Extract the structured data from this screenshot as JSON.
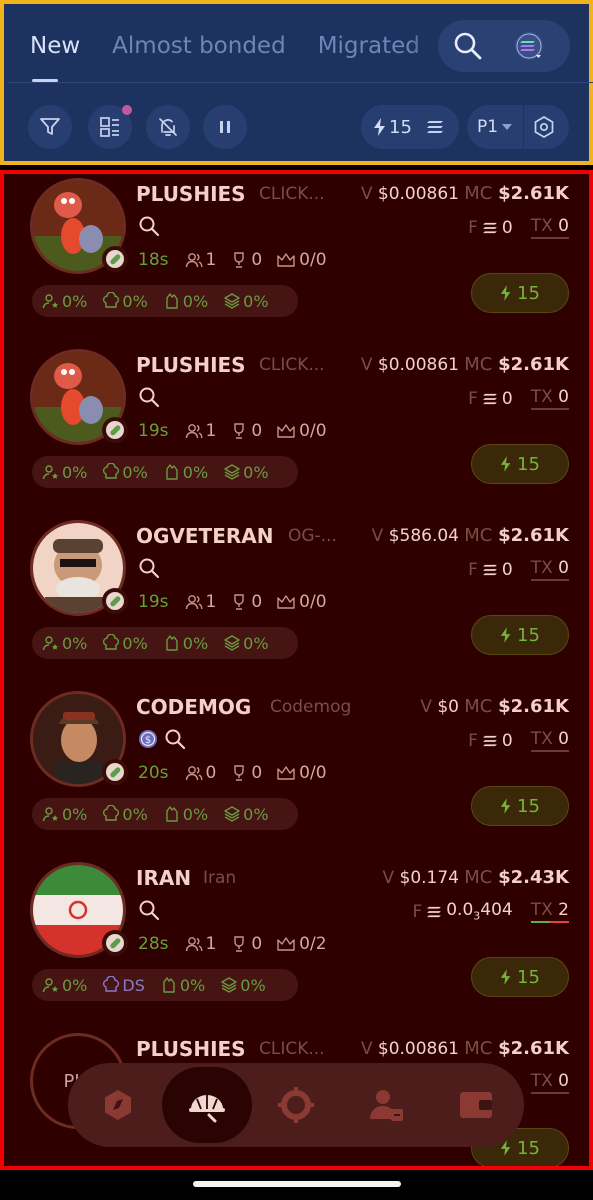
{
  "tabs": [
    {
      "label": "New",
      "active": true
    },
    {
      "label": "Almost bonded",
      "active": false
    },
    {
      "label": "Migrated",
      "active": false
    }
  ],
  "header": {
    "search_icon": "search-icon",
    "chain_icon": "solana-icon",
    "filter_icon": "filter-icon",
    "layout_icon": "layout-icon",
    "mute_icon": "bell-off-icon",
    "pause_icon": "pause-icon",
    "quick_buy_amount": "15",
    "preset_label": "P1",
    "notification_dot_color": "#c05a9e"
  },
  "tokens": [
    {
      "name": "PLUSHIES",
      "subname": "CLICK...",
      "volume_label": "V",
      "volume": "$0.00861",
      "mc_label": "MC",
      "mc": "$2.61K",
      "fee_label": "F",
      "fee": "0",
      "tx_label": "TX",
      "tx": "0",
      "age": "18s",
      "holders": "1",
      "trophies": "0",
      "crowns": "0/0",
      "stat1": "0%",
      "stat2": "0%",
      "stat3": "0%",
      "stat4": "0%",
      "buy": "15",
      "avatar": "plush-toys"
    },
    {
      "name": "PLUSHIES",
      "subname": "CLICK...",
      "volume_label": "V",
      "volume": "$0.00861",
      "mc_label": "MC",
      "mc": "$2.61K",
      "fee_label": "F",
      "fee": "0",
      "tx_label": "TX",
      "tx": "0",
      "age": "19s",
      "holders": "1",
      "trophies": "0",
      "crowns": "0/0",
      "stat1": "0%",
      "stat2": "0%",
      "stat3": "0%",
      "stat4": "0%",
      "buy": "15",
      "avatar": "plush-toys"
    },
    {
      "name": "OGVETERAN",
      "subname": "OG-...",
      "volume_label": "V",
      "volume": "$586.04",
      "mc_label": "MC",
      "mc": "$2.61K",
      "fee_label": "F",
      "fee": "0",
      "tx_label": "TX",
      "tx": "0",
      "age": "19s",
      "holders": "1",
      "trophies": "0",
      "crowns": "0/0",
      "stat1": "0%",
      "stat2": "0%",
      "stat3": "0%",
      "stat4": "0%",
      "buy": "15",
      "avatar": "veteran-cartoon"
    },
    {
      "name": "CODEMOG",
      "subname": "Codemog",
      "volume_label": "V",
      "volume": "$0",
      "mc_label": "MC",
      "mc": "$2.61K",
      "fee_label": "F",
      "fee": "0",
      "tx_label": "TX",
      "tx": "0",
      "age": "20s",
      "holders": "0",
      "trophies": "0",
      "crowns": "0/0",
      "stat1": "0%",
      "stat2": "0%",
      "stat3": "0%",
      "stat4": "0%",
      "buy": "15",
      "avatar": "person-photo",
      "extra_icon": "dollar-coin-icon"
    },
    {
      "name": "IRAN",
      "subname": "Iran",
      "volume_label": "V",
      "volume": "$0.174",
      "mc_label": "MC",
      "mc": "$2.43K",
      "fee_label": "F",
      "fee_value": "0.0",
      "fee_subscript": "3",
      "fee_tail": "404",
      "tx_label": "TX",
      "tx": "2",
      "age": "28s",
      "holders": "1",
      "trophies": "0",
      "crowns": "0/2",
      "stat1": "0%",
      "stat2": "DS",
      "stat3": "0%",
      "stat4": "0%",
      "buy": "15",
      "avatar": "iran-flag"
    },
    {
      "name": "PLUSHIES",
      "subname": "CLICK...",
      "volume_label": "V",
      "volume": "$0.00861",
      "mc_label": "MC",
      "mc": "$2.61K",
      "tx_label": "TX",
      "tx": "0",
      "buy": "15",
      "avatar_placeholder": "PL"
    }
  ],
  "bottom_nav": [
    {
      "icon": "discover-icon",
      "active": false
    },
    {
      "icon": "helmet-icon",
      "active": true
    },
    {
      "icon": "crosshair-icon",
      "active": false
    },
    {
      "icon": "users-icon",
      "active": false
    },
    {
      "icon": "wallet-icon",
      "active": false
    }
  ],
  "colors": {
    "header_bg": "#1e3260",
    "feed_bg": "#2e0000",
    "accent_green": "#76b33c",
    "header_outline": "#f2b21c",
    "feed_outline": "#f00000"
  }
}
